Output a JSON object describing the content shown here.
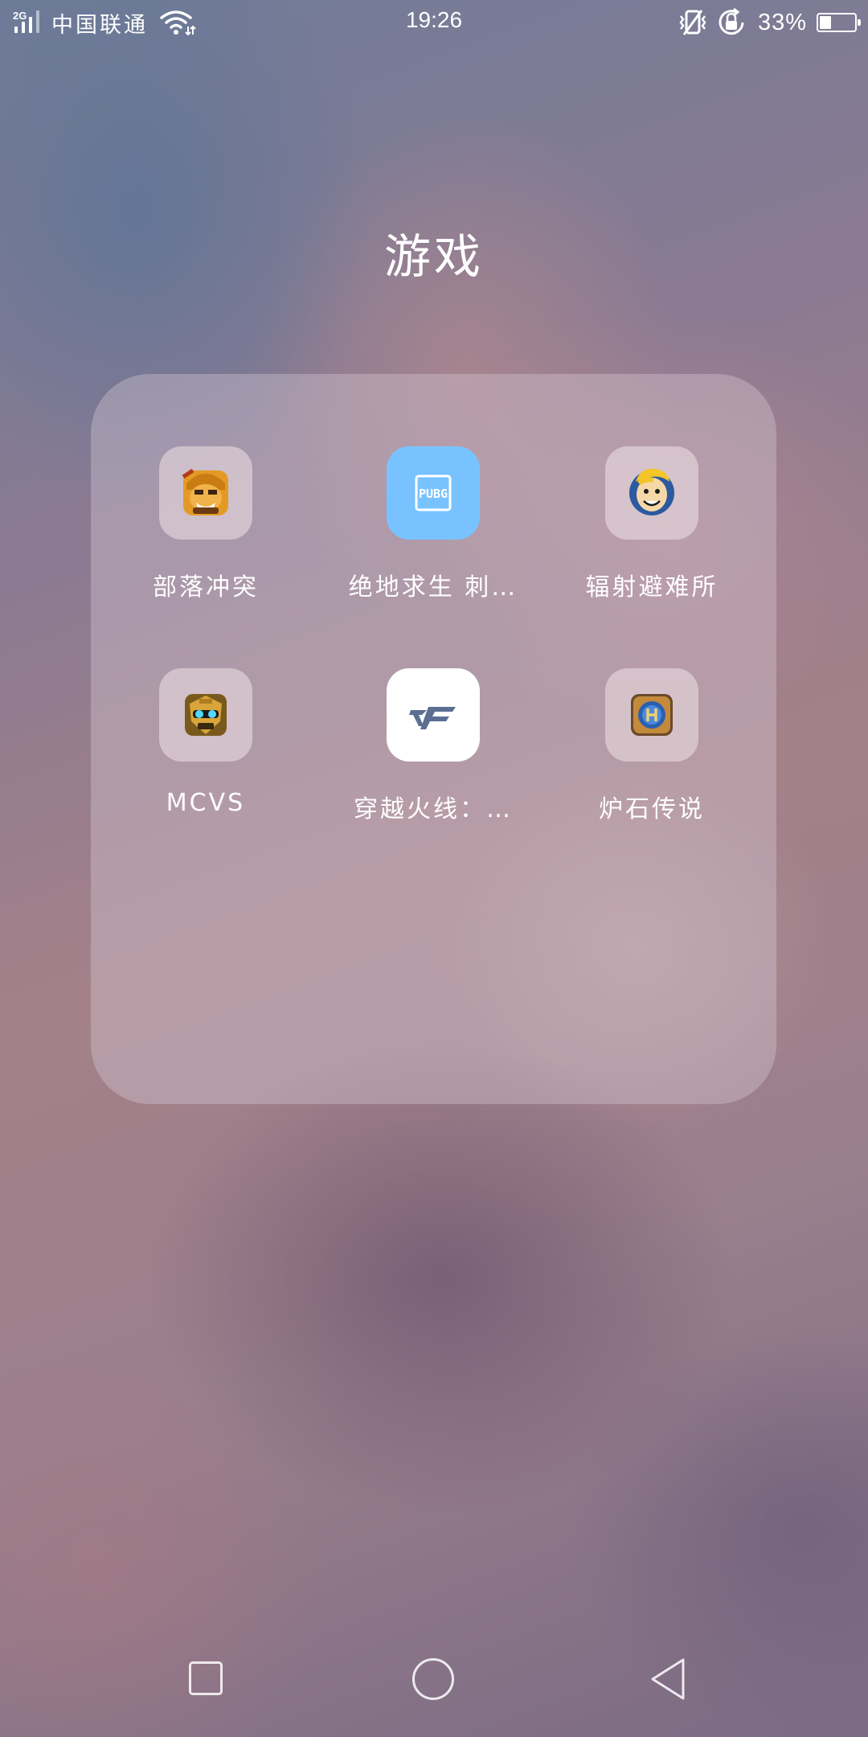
{
  "status_bar": {
    "network": "2G",
    "carrier": "中国联通",
    "time": "19:26",
    "battery_percent": "33%",
    "battery_level": 0.33,
    "icons": [
      "signal-icon",
      "wifi-icon",
      "vibrate-icon",
      "rotation-lock-icon",
      "battery-icon"
    ]
  },
  "folder": {
    "title": "游戏",
    "apps": [
      {
        "label": "部落冲突",
        "icon": "clash-of-clans-icon"
      },
      {
        "label": "绝地求生 刺…",
        "icon": "pubg-icon",
        "icon_text": "PUBG"
      },
      {
        "label": "辐射避难所",
        "icon": "fallout-shelter-icon"
      },
      {
        "label": "MCVS",
        "icon": "mcvs-icon"
      },
      {
        "label": "穿越火线：…",
        "icon": "crossfire-icon"
      },
      {
        "label": "炉石传说",
        "icon": "hearthstone-icon"
      }
    ]
  },
  "nav_bar": {
    "buttons": [
      "recent-apps",
      "home",
      "back"
    ]
  },
  "colors": {
    "pubg_bg": "#78c3ff",
    "folder_panel": "rgba(220,205,215,0.36)"
  }
}
